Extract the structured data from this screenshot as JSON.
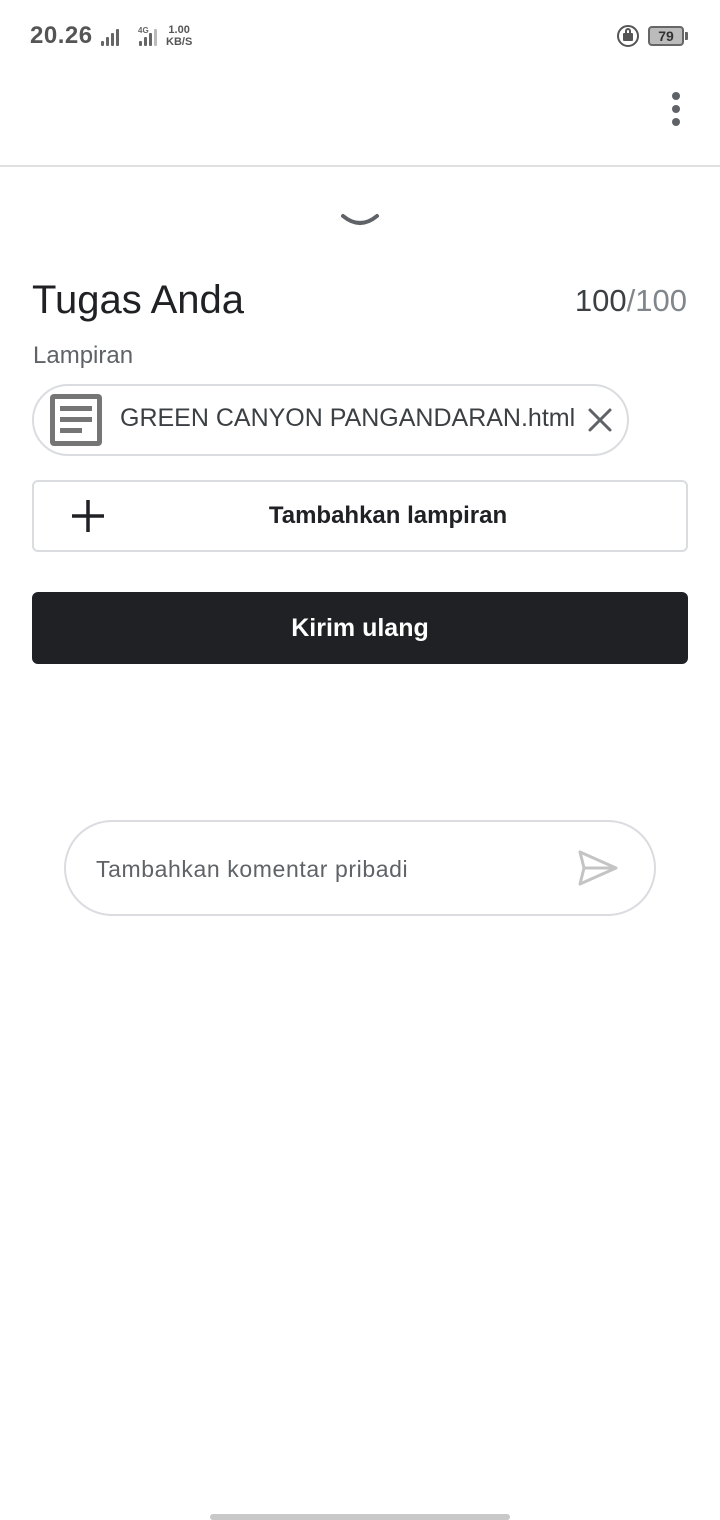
{
  "status_bar": {
    "time": "20.26",
    "network_type": "4G",
    "speed_value": "1.00",
    "speed_unit": "KB/S",
    "battery_level": "79"
  },
  "header": {
    "more_icon": "more-vert-icon"
  },
  "sheet": {
    "collapse_icon": "chevron-down-icon",
    "title": "Tugas Anda",
    "grade_earned": "100",
    "grade_total": "/100",
    "attachments_label": "Lampiran",
    "attachments": [
      {
        "name": "GREEN CANYON PANGANDARAN.html",
        "icon": "document-icon",
        "remove_icon": "close-icon"
      }
    ],
    "add_attachment_label": "Tambahkan lampiran",
    "add_icon": "plus-icon",
    "resubmit_label": "Kirim ulang"
  },
  "comment": {
    "placeholder": "Tambahkan komentar pribadi",
    "value": "",
    "send_icon": "send-icon"
  },
  "colors": {
    "primary_button": "#202124",
    "border": "#dadce0",
    "muted_text": "#5f6368"
  }
}
